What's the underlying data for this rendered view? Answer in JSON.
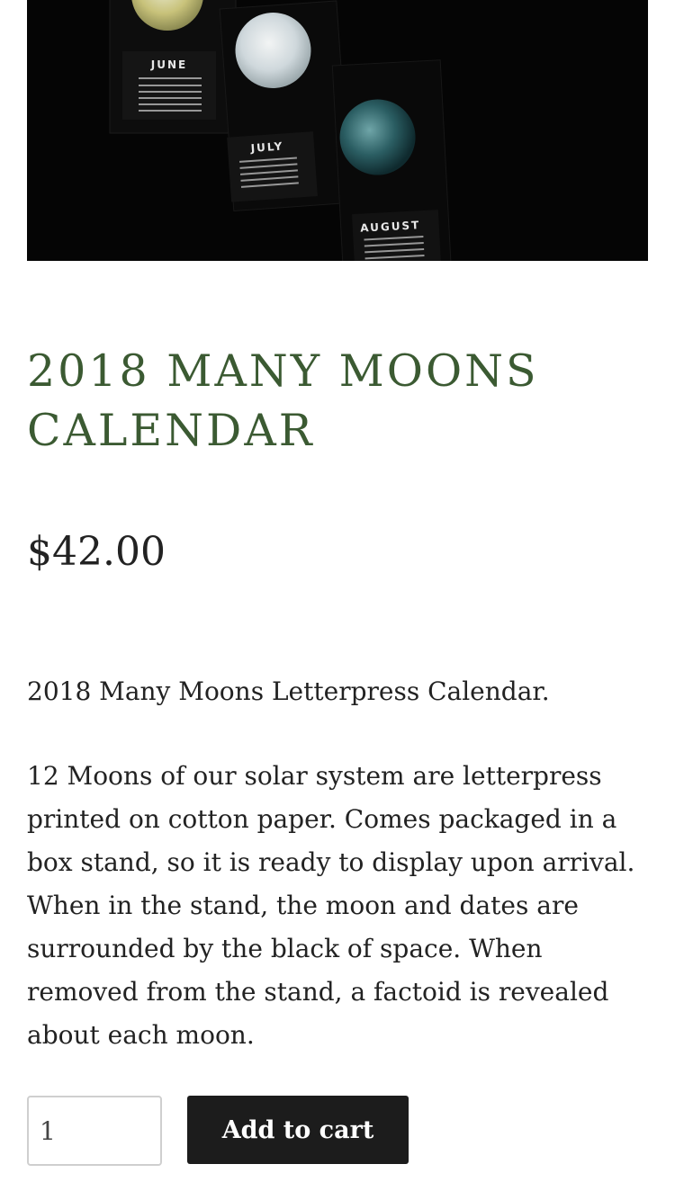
{
  "hero": {
    "image_alt": "Calendar pages with moons on a black background",
    "month_labels": [
      "JUNE",
      "JULY",
      "AUGUST"
    ]
  },
  "product": {
    "title": "2018 MANY MOONS CALENDAR",
    "price": "$42.00",
    "description": [
      "2018 Many Moons Letterpress Calendar.",
      "12 Moons of our solar system are letterpress printed on cotton paper. Comes packaged in a box stand, so it is ready to display upon arrival. When in the stand, the moon and dates are surrounded by the black of space. When removed from the stand, a factoid is revealed about each moon."
    ]
  },
  "cart": {
    "quantity": "1",
    "add_label": "Add to cart"
  },
  "colors": {
    "title": "#3b5a32",
    "button_bg": "#1c1c1c",
    "hero_bg": "#050505"
  }
}
